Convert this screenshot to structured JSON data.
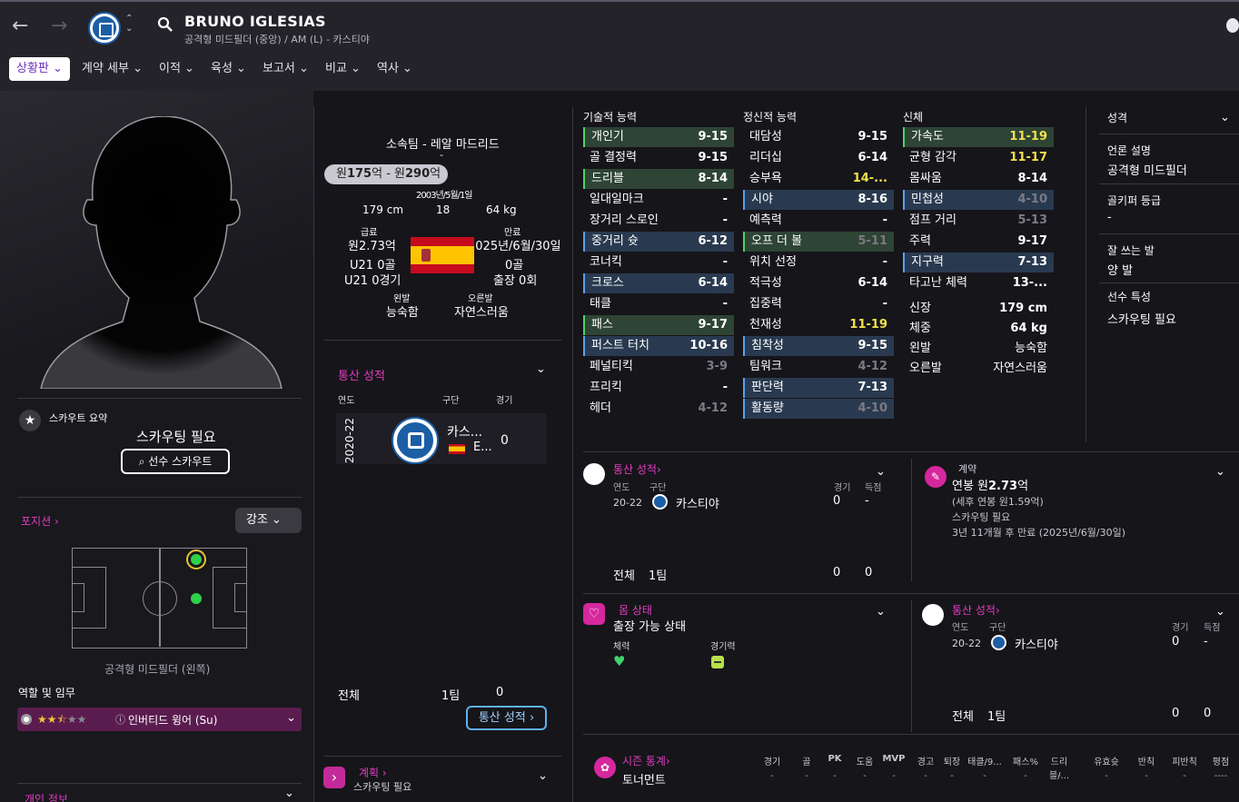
{
  "header": {
    "player_name": "BRUNO IGLESIAS",
    "subtitle": "공격형 미드필더 (중앙) / AM (L) - 카스티야"
  },
  "tabs": [
    {
      "label": "상황판"
    },
    {
      "label": "계약 세부"
    },
    {
      "label": "이적"
    },
    {
      "label": "육성"
    },
    {
      "label": "보고서"
    },
    {
      "label": "비교"
    },
    {
      "label": "역사"
    }
  ],
  "scout_summary": {
    "label": "스카우트 요약",
    "status": "스카우팅 필요",
    "button": "선수 스카우트"
  },
  "position": {
    "title": "포지션",
    "emphasis": "강조",
    "position_label": "공격형 미드필더 (왼쪽)"
  },
  "role": {
    "title": "역할 및 임무",
    "role_name": "인버티드 윙어 (Su)"
  },
  "personal": {
    "title": "개인 정보"
  },
  "info": {
    "club_label": "소속팀 - 레알 마드리드",
    "dash": "-",
    "value_range_a": "원",
    "value_range_b": "175",
    "value_range_c": "억 - 원",
    "value_range_d": "290",
    "value_range_e": "억",
    "birth": "2003년/5월/1일",
    "height": "179 cm",
    "age": "18",
    "weight": "64 kg",
    "wage_label": "급료",
    "wage": "원2.73억",
    "expiry_label": "만료",
    "expiry": "2025년/6월/30일",
    "u21_goals": "U21 0골",
    "goals": "0골",
    "u21_apps": "U21 0경기",
    "apps": "출장 0회",
    "left_foot_label": "왼발",
    "left_foot": "능숙함",
    "right_foot_label": "오른발",
    "right_foot": "자연스러움"
  },
  "career_left": {
    "title": "통산 성적",
    "col_year": "연도",
    "col_level": "구단",
    "col_apps": "경기",
    "season": "2020-22",
    "club_short": "카스...",
    "nation_short": "E...",
    "apps": "0",
    "total_label": "전체",
    "total_team": "1팀",
    "total_apps": "0",
    "button": "통산 성적"
  },
  "plan": {
    "title": "계획",
    "status": "스카우팅 필요"
  },
  "attributes": {
    "technical_title": "기술적 능력",
    "mental_title": "정신적 능력",
    "physical_title": "신체",
    "technical": [
      {
        "name": "개인기",
        "value": "9-15"
      },
      {
        "name": "골 결정력",
        "value": "9-15"
      },
      {
        "name": "드리블",
        "value": "8-14"
      },
      {
        "name": "일대일마크",
        "value": "-"
      },
      {
        "name": "장거리 스로인",
        "value": "-"
      },
      {
        "name": "중거리 슛",
        "value": "6-12"
      },
      {
        "name": "코너킥",
        "value": "-"
      },
      {
        "name": "크로스",
        "value": "6-14"
      },
      {
        "name": "태클",
        "value": "-"
      },
      {
        "name": "패스",
        "value": "9-17"
      },
      {
        "name": "퍼스트 터치",
        "value": "10-16"
      },
      {
        "name": "페널티킥",
        "value": "3-9"
      },
      {
        "name": "프리킥",
        "value": "-"
      },
      {
        "name": "헤더",
        "value": "4-12"
      }
    ],
    "mental": [
      {
        "name": "대담성",
        "value": "9-15"
      },
      {
        "name": "리더십",
        "value": "6-14"
      },
      {
        "name": "승부욕",
        "value": "14-..."
      },
      {
        "name": "시야",
        "value": "8-16"
      },
      {
        "name": "예측력",
        "value": "-"
      },
      {
        "name": "오프 더 볼",
        "value": "5-11"
      },
      {
        "name": "위치 선정",
        "value": "-"
      },
      {
        "name": "적극성",
        "value": "6-14"
      },
      {
        "name": "집중력",
        "value": "-"
      },
      {
        "name": "천재성",
        "value": "11-19"
      },
      {
        "name": "침착성",
        "value": "9-15"
      },
      {
        "name": "팀워크",
        "value": "4-12"
      },
      {
        "name": "판단력",
        "value": "7-13"
      },
      {
        "name": "활동량",
        "value": "4-10"
      }
    ],
    "physical": [
      {
        "name": "가속도",
        "value": "11-19"
      },
      {
        "name": "균형 감각",
        "value": "11-17"
      },
      {
        "name": "몸싸움",
        "value": "8-14"
      },
      {
        "name": "민첩성",
        "value": "4-10"
      },
      {
        "name": "점프 거리",
        "value": "5-13"
      },
      {
        "name": "주력",
        "value": "9-17"
      },
      {
        "name": "지구력",
        "value": "7-13"
      },
      {
        "name": "타고난 체력",
        "value": "13-..."
      }
    ],
    "physical_info": [
      {
        "name": "신장",
        "value": "179 cm"
      },
      {
        "name": "체중",
        "value": "64 kg"
      },
      {
        "name": "왼발",
        "value": "능숙함"
      },
      {
        "name": "오른발",
        "value": "자연스러움"
      }
    ]
  },
  "personality": {
    "title": "성격",
    "desc_label": "언론 설명",
    "desc": "공격형 미드필더",
    "gk_label": "골키퍼 등급",
    "gk": "-",
    "foot_label": "잘 쓰는 발",
    "foot": "양 발",
    "traits_label": "선수 특성",
    "traits": "스카우팅 필요"
  },
  "career_mid": {
    "title": "통산 성적",
    "col_year": "연도",
    "col_club": "구단",
    "col_apps": "경기",
    "col_goals": "득점",
    "year": "20-22",
    "club": "카스티야",
    "apps": "0",
    "goals": "-",
    "total": "전체",
    "total_team": "1팀",
    "total_apps": "0",
    "total_goals": "0"
  },
  "contract": {
    "title": "계약",
    "salary_a": "연봉 원",
    "salary_b": "2.73",
    "salary_c": "억",
    "after_tax": "(세후 연봉 원1.59억)",
    "status": "스카우팅 필요",
    "expiry": "3년 11개월 후 만료 (2025년/6월/30일)"
  },
  "condition": {
    "title": "몸 상태",
    "status": "출장 가능 상태",
    "fitness": "체력",
    "match_exp": "경기력"
  },
  "career_right": {
    "title": "통산 성적",
    "col_year": "연도",
    "col_club": "구단",
    "col_apps": "경기",
    "col_goals": "득점",
    "year": "20-22",
    "club": "카스티야",
    "apps": "0",
    "goals": "-",
    "total": "전체",
    "total_team": "1팀",
    "total_apps": "0",
    "total_goals": "0"
  },
  "season": {
    "title": "시즌 통계",
    "competition": "토너먼트",
    "cols": [
      "경기",
      "골",
      "PK",
      "도움",
      "MVP",
      "경고",
      "퇴장",
      "태클/9...",
      "패스%",
      "드리블/...",
      "유효슛",
      "반칙",
      "피반칙",
      "평점"
    ],
    "vals": [
      "-",
      "-",
      "-",
      "-",
      "-",
      "-",
      "-",
      "-",
      "-",
      "-",
      "-",
      "-",
      "-",
      "----"
    ]
  }
}
